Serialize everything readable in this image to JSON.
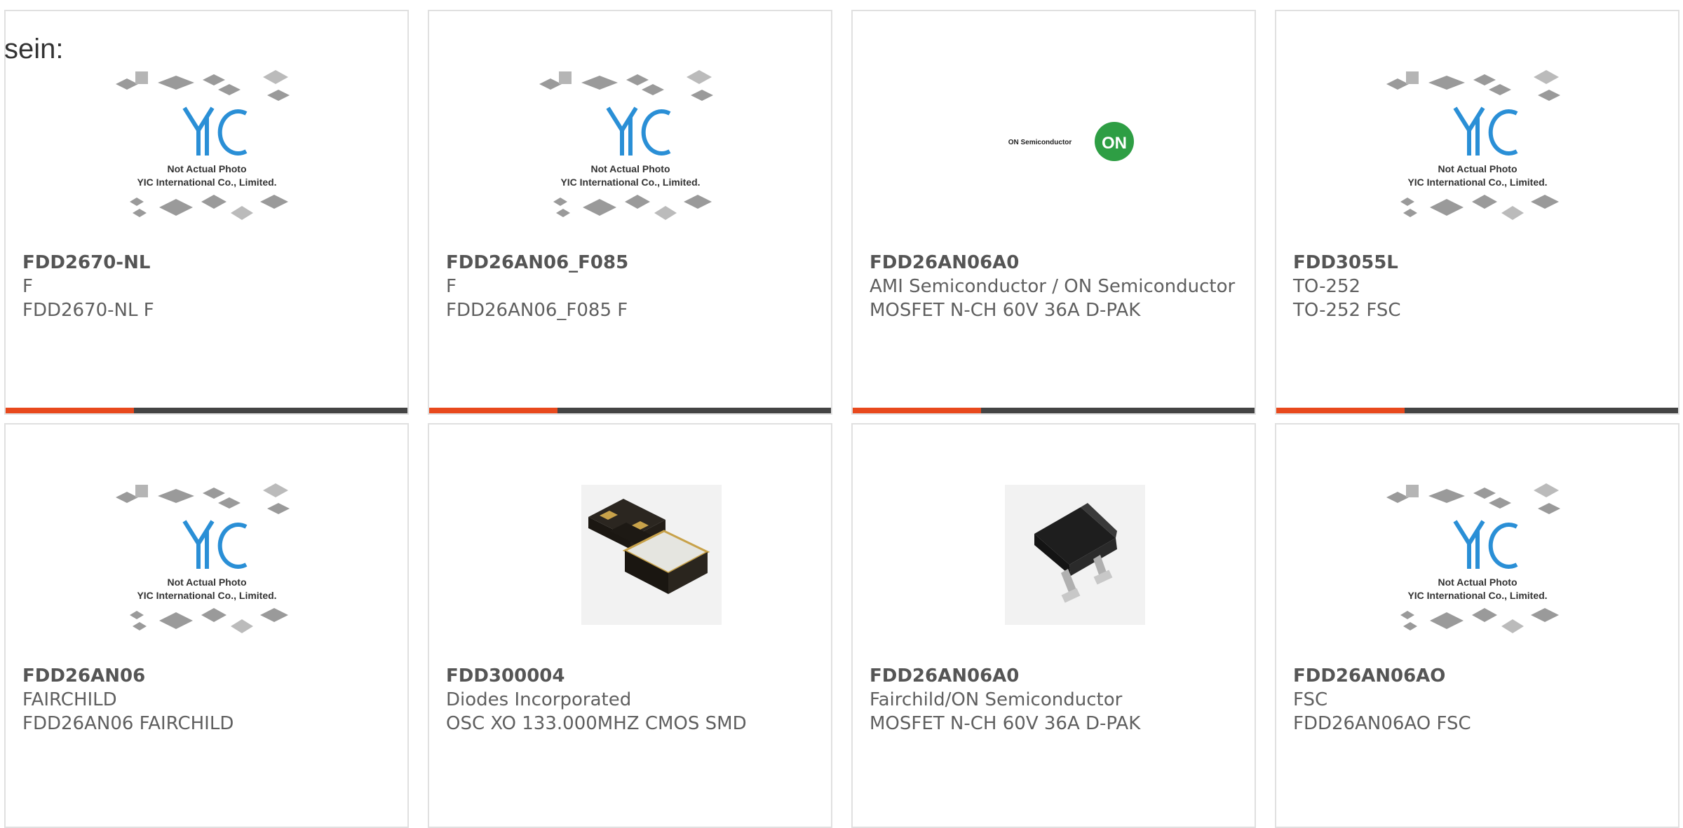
{
  "intro_text": "sein:",
  "placeholder_image": {
    "line1": "Not Actual Photo",
    "line2": "YIC International Co., Limited.",
    "logo": "YIC"
  },
  "on_logo": {
    "text": "ON Semiconductor",
    "badge": "ON"
  },
  "colors": {
    "accent": "#e8491d",
    "bar": "#444444",
    "logo_blue": "#2a8fd6",
    "on_green": "#2e9e44"
  },
  "products": [
    {
      "part": "FDD2670-NL",
      "manufacturer": "F",
      "description": "FDD2670-NL F",
      "image": "yic-placeholder"
    },
    {
      "part": "FDD26AN06_F085",
      "manufacturer": "F",
      "description": "FDD26AN06_F085 F",
      "image": "yic-placeholder"
    },
    {
      "part": "FDD26AN06A0",
      "manufacturer": "AMI Semiconductor / ON Semiconductor",
      "description": "MOSFET N-CH 60V 36A D-PAK",
      "image": "on-semiconductor-logo"
    },
    {
      "part": "FDD3055L",
      "manufacturer": "TO-252",
      "description": "TO-252 FSC",
      "image": "yic-placeholder"
    },
    {
      "part": "FDD26AN06",
      "manufacturer": "FAIRCHILD",
      "description": "FDD26AN06 FAIRCHILD",
      "image": "yic-placeholder"
    },
    {
      "part": "FDD300004",
      "manufacturer": "Diodes Incorporated",
      "description": "OSC XO 133.000MHZ CMOS SMD",
      "image": "crystal-oscillator-photo"
    },
    {
      "part": "FDD26AN06A0",
      "manufacturer": "Fairchild/ON Semiconductor",
      "description": "MOSFET N-CH 60V 36A D-PAK",
      "image": "dpak-transistor-photo"
    },
    {
      "part": "FDD26AN06AO",
      "manufacturer": "FSC",
      "description": "FDD26AN06AO FSC",
      "image": "yic-placeholder"
    }
  ]
}
